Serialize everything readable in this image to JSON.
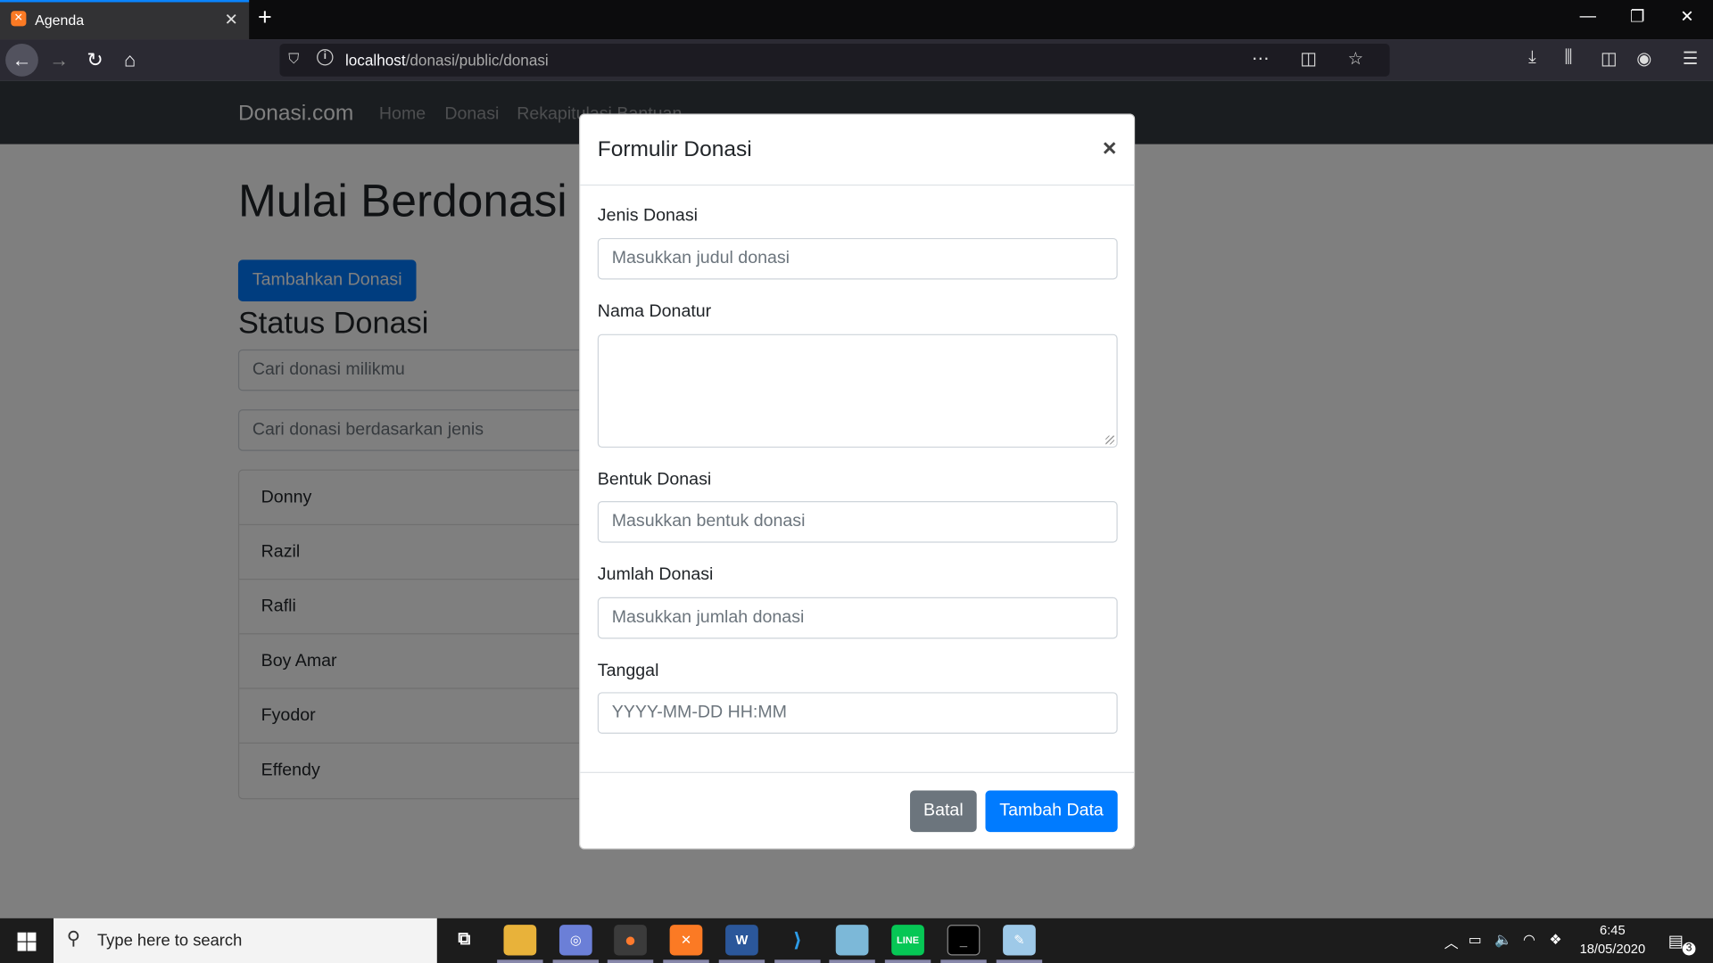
{
  "browser": {
    "tab_title": "Agenda",
    "tab_close": "✕",
    "new_tab": "+",
    "url_host": "localhost",
    "url_path": "/donasi/public/donasi",
    "url_actions": "⋯ ◫ ☆"
  },
  "site": {
    "brand": "Donasi.com",
    "nav": [
      "Home",
      "Donasi",
      "Rekapitulasi Bantuan"
    ]
  },
  "main": {
    "title": "Mulai Berdonasi",
    "add_button": "Tambahkan Donasi",
    "status_title": "Status Donasi",
    "search_own_placeholder": "Cari donasi milikmu",
    "search_type_placeholder": "Cari donasi berdasarkan jenis",
    "donors": [
      "Donny",
      "Razil",
      "Rafli",
      "Boy Amar",
      "Fyodor",
      "Effendy"
    ]
  },
  "modal": {
    "title": "Formulir Donasi",
    "close": "×",
    "fields": {
      "jenis_label": "Jenis Donasi",
      "jenis_placeholder": "Masukkan judul donasi",
      "nama_label": "Nama Donatur",
      "bentuk_label": "Bentuk Donasi",
      "bentuk_placeholder": "Masukkan bentuk donasi",
      "jumlah_label": "Jumlah Donasi",
      "jumlah_placeholder": "Masukkan jumlah donasi",
      "tanggal_label": "Tanggal",
      "tanggal_placeholder": "YYYY-MM-DD HH:MM"
    },
    "cancel_button": "Batal",
    "submit_button": "Tambah Data"
  },
  "taskbar": {
    "search_placeholder": "Type here to search",
    "time": "6:45",
    "date": "18/05/2020",
    "notification_count": "3"
  },
  "colors": {
    "primary": "#007bff",
    "secondary": "#6c757d",
    "navbar": "#343a40"
  }
}
